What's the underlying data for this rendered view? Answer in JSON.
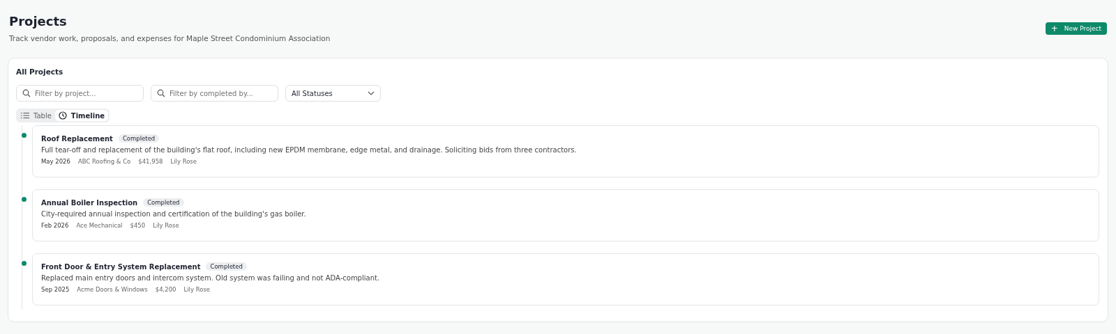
{
  "header": {
    "title": "Projects",
    "subtitle": "Track vendor work, proposals, and expenses for Maple Street Condominium Association",
    "new_button": {
      "icon": "+",
      "label": "New Project"
    }
  },
  "panel": {
    "title": "All Projects",
    "filters": [
      {
        "placeholder": "Filter by project..."
      },
      {
        "placeholder": "Filter by completed by..."
      }
    ],
    "status_select": {
      "value": "All Statuses"
    },
    "views": [
      {
        "label": "Table",
        "kind": "list",
        "selected": false
      },
      {
        "label": "Timeline",
        "kind": "clock",
        "selected": true
      }
    ],
    "projects": [
      {
        "title": "Roof Replacement",
        "status": "Completed",
        "description": "Full tear-off and replacement of the building's flat roof, including new EPDM membrane, edge metal, and drainage. Soliciting bids from three contractors.",
        "date": "May 2026",
        "vendor": "ABC Roofing & Co",
        "amount": "$41,958",
        "person": "Lily Rose"
      },
      {
        "title": "Annual Boiler Inspection",
        "status": "Completed",
        "description": "City-required annual inspection and certification of the building's gas boiler.",
        "date": "Feb 2026",
        "vendor": "Ace Mechanical",
        "amount": "$450",
        "person": "Lily Rose"
      },
      {
        "title": "Front Door & Entry System Replacement",
        "status": "Completed",
        "description": "Replaced main entry doors and intercom system. Old system was failing and not ADA-compliant.",
        "date": "Sep 2025",
        "vendor": "Acme Doors & Windows",
        "amount": "$4,200",
        "person": "Lily Rose"
      }
    ]
  }
}
